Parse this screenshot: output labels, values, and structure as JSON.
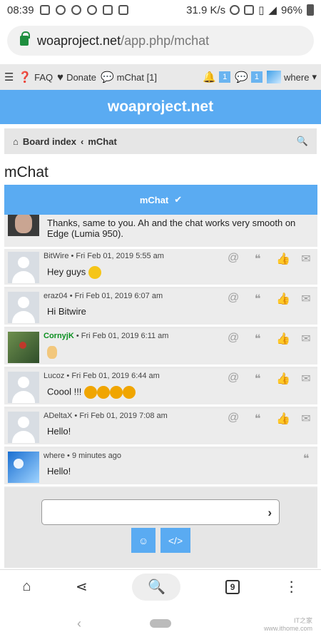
{
  "status_bar": {
    "time": "08:39",
    "net_speed": "31.9 K/s",
    "battery": "96%"
  },
  "browser": {
    "url_host": "woaproject.net",
    "url_path": "/app.php/mchat",
    "tab_count": "9"
  },
  "nav": {
    "faq": "FAQ",
    "donate": "Donate",
    "mchat": "mChat [1]",
    "notifications": "1",
    "messages": "1",
    "user": "where"
  },
  "site_title": "woaproject.net",
  "breadcrumb": {
    "board_index": "Board index",
    "separator": "‹",
    "current": "mChat"
  },
  "page_title": "mChat",
  "mchat_header": "mChat",
  "messages": [
    {
      "author": "",
      "time": "",
      "text_line1": "Thanks, same to you. Ah and the chat works very smooth on",
      "text_line2": "Edge (Lumia 950)."
    },
    {
      "author": "BitWire",
      "time": "Fri Feb 01, 2019 5:55 am",
      "text": "Hey guys"
    },
    {
      "author": "eraz04",
      "time": "Fri Feb 01, 2019 6:07 am",
      "text": "Hi Bitwire"
    },
    {
      "author": "CornyjK",
      "time": "Fri Feb 01, 2019 6:11 am",
      "text": ""
    },
    {
      "author": "Lucoz",
      "time": "Fri Feb 01, 2019 6:44 am",
      "text": "Coool !!!"
    },
    {
      "author": "ADeltaX",
      "time": "Fri Feb 01, 2019 7:08 am",
      "text": "Hello!"
    },
    {
      "author": "where",
      "time": "9 minutes ago",
      "text": "Hello!"
    }
  ],
  "compose": {
    "value": "",
    "placeholder": ""
  },
  "colors": {
    "accent": "#5aabf2",
    "author_green": "#0a8f1f"
  },
  "watermark": {
    "line1": "IT之家",
    "line2": "www.ithome.com"
  }
}
